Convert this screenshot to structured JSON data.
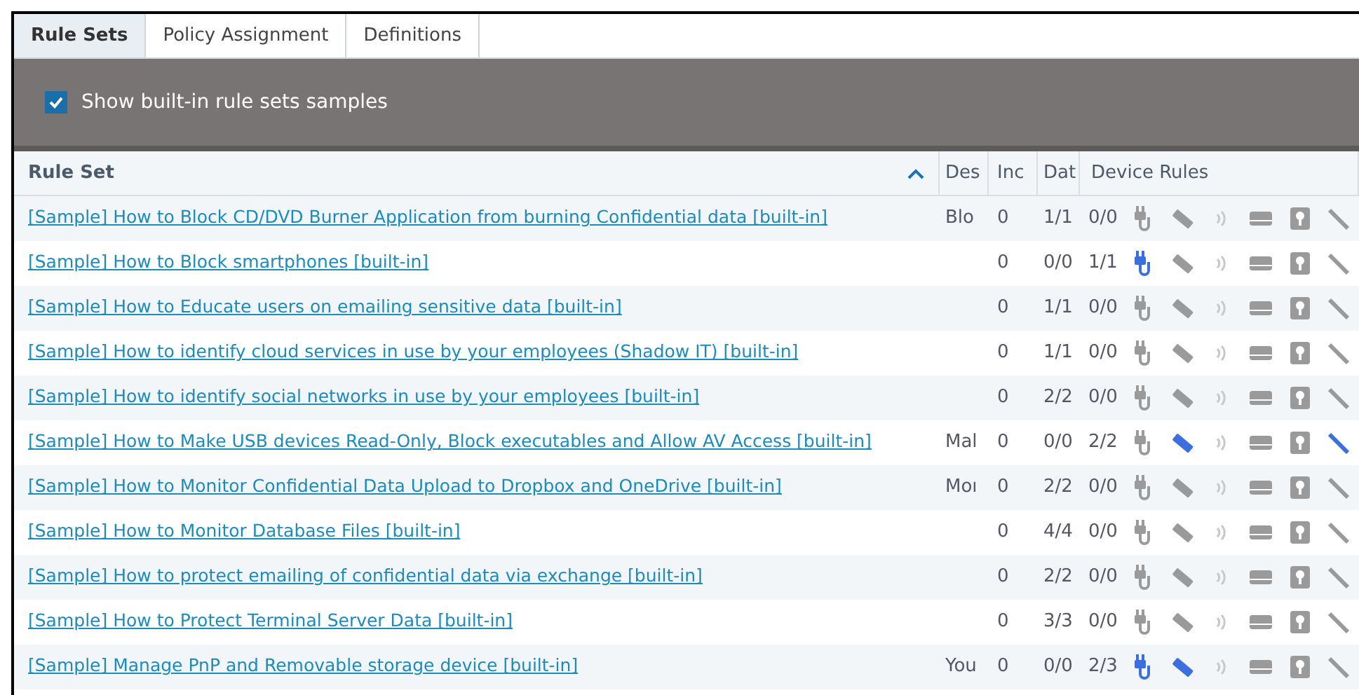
{
  "tabs": [
    {
      "label": "Rule Sets",
      "selected": true
    },
    {
      "label": "Policy Assignment",
      "selected": false
    },
    {
      "label": "Definitions",
      "selected": false
    }
  ],
  "toolbar": {
    "label": "Show built-in rule sets samples",
    "checked": true
  },
  "table": {
    "columns": [
      "Rule Set",
      "Des",
      "Inc",
      "Dat",
      "Device Rules"
    ],
    "rows": [
      {
        "name": "[Sample] How to Block CD/DVD Burner Application from burning Confidential data [built-in]",
        "column_2": "Blo",
        "column_3": "0",
        "column_4": "1/1",
        "device_count": "0/0",
        "device_rules": [
          false,
          false,
          false,
          false,
          false,
          false
        ]
      },
      {
        "name": "[Sample] How to Block smartphones [built-in]",
        "column_2": "",
        "column_3": "0",
        "column_4": "0/0",
        "device_count": "1/1",
        "device_rules": [
          true,
          false,
          false,
          false,
          false,
          false
        ]
      },
      {
        "name": "[Sample] How to Educate users on emailing sensitive data [built-in]",
        "column_2": "",
        "column_3": "0",
        "column_4": "1/1",
        "device_count": "0/0",
        "device_rules": [
          false,
          false,
          false,
          false,
          false,
          false
        ]
      },
      {
        "name": "[Sample] How to identify cloud services in use by your employees (Shadow IT) [built-in]",
        "column_2": "",
        "column_3": "0",
        "column_4": "1/1",
        "device_count": "0/0",
        "device_rules": [
          false,
          false,
          false,
          false,
          false,
          false
        ]
      },
      {
        "name": "[Sample] How to identify social networks in use by your employees [built-in]",
        "column_2": "",
        "column_3": "0",
        "column_4": "2/2",
        "device_count": "0/0",
        "device_rules": [
          false,
          false,
          false,
          false,
          false,
          false
        ]
      },
      {
        "name": "[Sample] How to Make USB devices Read-Only, Block executables and Allow AV Access [built-in]",
        "column_2": "Mal",
        "column_3": "0",
        "column_4": "0/0",
        "device_count": "2/2",
        "device_rules": [
          false,
          true,
          false,
          false,
          false,
          true
        ]
      },
      {
        "name": "[Sample] How to Monitor Confidential Data Upload to Dropbox and OneDrive [built-in]",
        "column_2": "Moı",
        "column_3": "0",
        "column_4": "2/2",
        "device_count": "0/0",
        "device_rules": [
          false,
          false,
          false,
          false,
          false,
          false
        ]
      },
      {
        "name": "[Sample] How to Monitor Database Files [built-in]",
        "column_2": "",
        "column_3": "0",
        "column_4": "4/4",
        "device_count": "0/0",
        "device_rules": [
          false,
          false,
          false,
          false,
          false,
          false
        ]
      },
      {
        "name": "[Sample] How to protect emailing of confidential data via exchange [built-in]",
        "column_2": "",
        "column_3": "0",
        "column_4": "2/2",
        "device_count": "0/0",
        "device_rules": [
          false,
          false,
          false,
          false,
          false,
          false
        ]
      },
      {
        "name": "[Sample] How to Protect Terminal Server Data [built-in]",
        "column_2": "",
        "column_3": "0",
        "column_4": "3/3",
        "device_count": "0/0",
        "device_rules": [
          false,
          false,
          false,
          false,
          false,
          false
        ]
      },
      {
        "name": "[Sample] Manage PnP and Removable storage device [built-in]",
        "column_2": "You",
        "column_3": "0",
        "column_4": "0/0",
        "device_count": "2/3",
        "device_rules": [
          true,
          true,
          false,
          false,
          false,
          false
        ]
      }
    ]
  }
}
